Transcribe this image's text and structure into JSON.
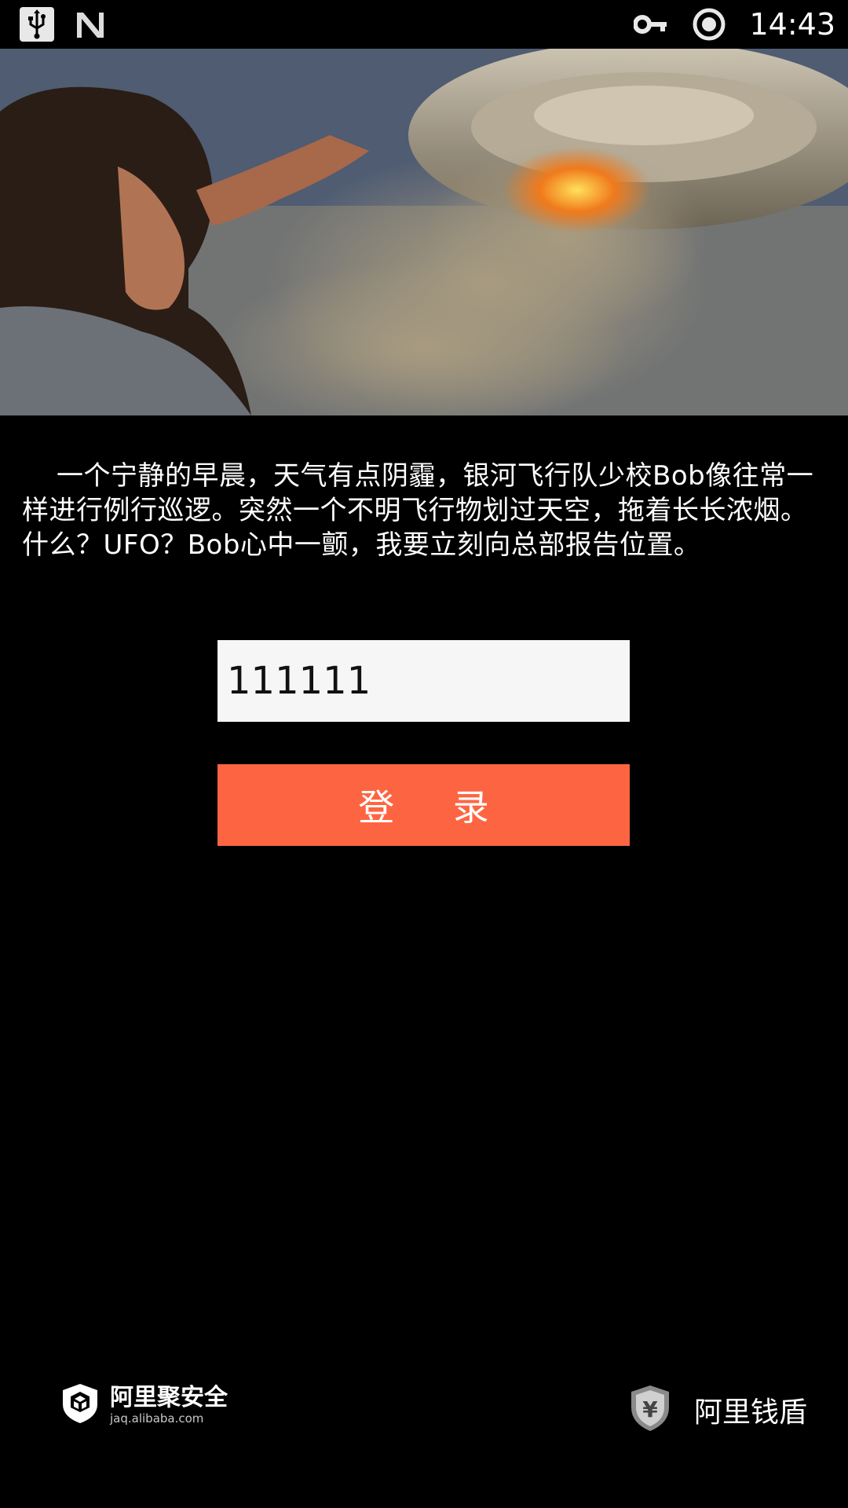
{
  "status_bar": {
    "time": "14:43",
    "icons": [
      "usb-icon",
      "n-logo-icon",
      "vpn-key-icon",
      "sync-circle-icon"
    ]
  },
  "hero": {
    "image": "man-watching-ufo-with-smoke"
  },
  "story": {
    "text": "一个宁静的早晨，天气有点阴霾，银河飞行队少校Bob像往常一样进行例行巡逻。突然一个不明飞行物划过天空，拖着长长浓烟。什么？UFO？Bob心中一颤，我要立刻向总部报告位置。"
  },
  "form": {
    "code_value": "111111",
    "login_label": "登 录"
  },
  "footer": {
    "left_brand": "阿里聚安全",
    "left_domain": "jaq.alibaba.com",
    "right_brand": "阿里钱盾"
  },
  "colors": {
    "background": "#000000",
    "button": "#fd6542",
    "input_bg": "#f6f6f6"
  }
}
